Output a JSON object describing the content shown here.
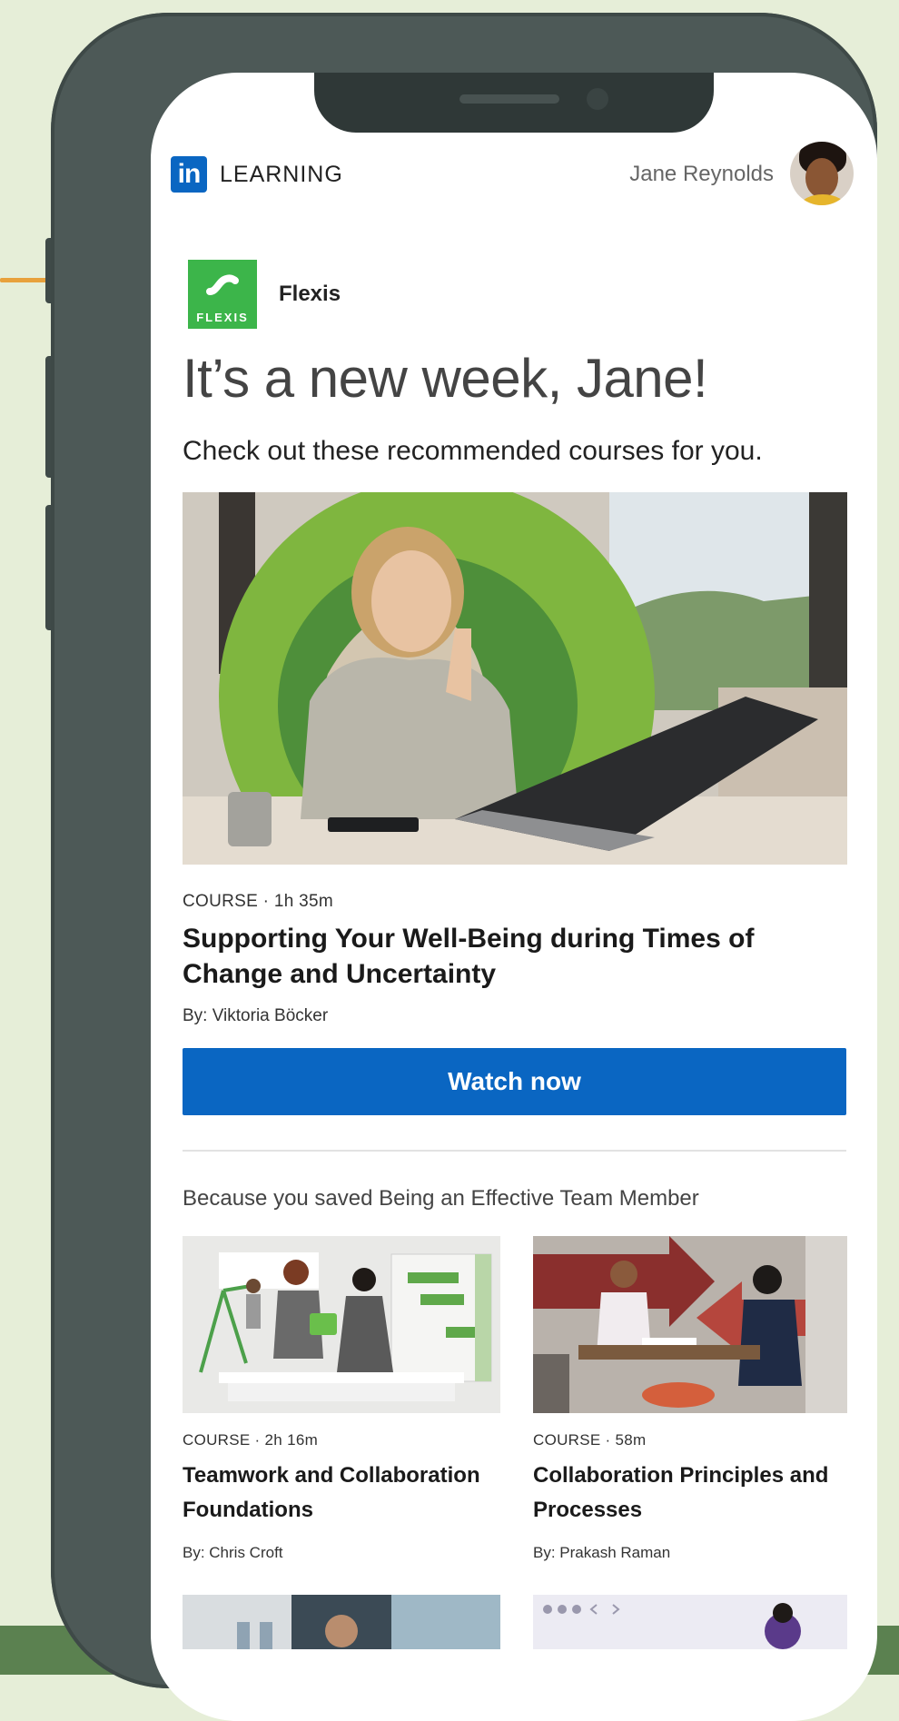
{
  "header": {
    "logo_text": "in",
    "product_label": "LEARNING",
    "user_name": "Jane Reynolds"
  },
  "organization": {
    "logo_word": "FLEXIS",
    "name": "Flexis"
  },
  "greeting": {
    "headline": "It’s a new week, Jane!",
    "subline": "Check out these recommended courses for you."
  },
  "featured_course": {
    "meta": "COURSE · 1h 35m",
    "title": "Supporting Your Well-Being during Times of Change and Uncertainty",
    "author": "By: Viktoria Böcker",
    "cta_label": "Watch now"
  },
  "recommendations": {
    "heading": "Because you saved Being an Effective Team Member",
    "courses": [
      {
        "meta": "COURSE · 2h 16m",
        "title": "Teamwork and Collaboration Foundations",
        "author": "By: Chris Croft"
      },
      {
        "meta": "COURSE · 58m",
        "title": "Collaboration Principles and Processes",
        "author": "By: Prakash Raman"
      }
    ]
  },
  "colors": {
    "linkedin_blue": "#0a66c2",
    "flexis_green": "#3cb54a",
    "accent_orange": "#e8a13c",
    "phone_frame": "#4d5957",
    "background": "#e6eed8"
  }
}
